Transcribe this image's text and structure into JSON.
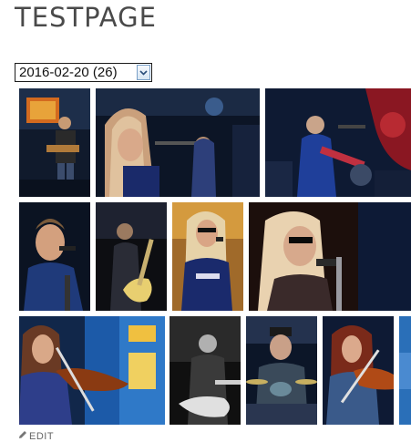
{
  "page": {
    "title": "TESTPAGE"
  },
  "gallery_select": {
    "selected": "2016-02-20 (26)",
    "icon": "chevron-down-icon"
  },
  "footer": {
    "edit_label": "EDIT",
    "icon": "pencil-icon"
  },
  "photos_row1": [
    "photo-guitarist-stage",
    "photo-long-hair-singer",
    "photo-band-blue-light"
  ],
  "photos_row2": [
    "photo-singer-mic",
    "photo-guitarist-dark",
    "photo-singer-sunglasses",
    "photo-singer-closeup"
  ],
  "photos_row3": [
    "photo-violinist",
    "photo-bassist-bw",
    "photo-drummer",
    "photo-violinist-red-hair",
    "photo-partial"
  ]
}
